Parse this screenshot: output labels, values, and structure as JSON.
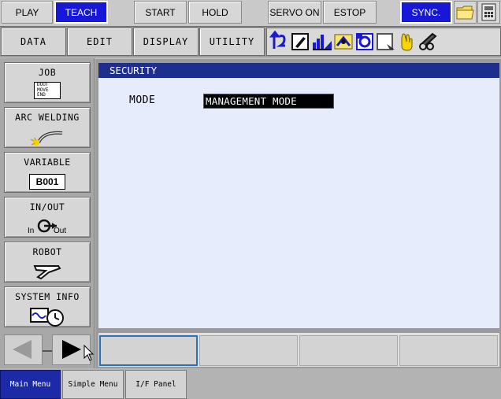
{
  "status_bar": {
    "play": "PLAY",
    "teach": "TEACH",
    "start": "START",
    "hold": "HOLD",
    "servo_on": "SERVO ON",
    "estop": "ESTOP",
    "sync": "SYNC.",
    "icons": [
      "folder-icon",
      "teach-pendant-icon"
    ]
  },
  "menu": {
    "data": "DATA",
    "edit": "EDIT",
    "display": "DISPLAY",
    "utility": "UTILITY",
    "status_icons": [
      "cycle-icon",
      "edit-icon",
      "signal-icon",
      "coordinate-icon",
      "tool-icon",
      "page-icon",
      "hand-icon",
      "security-key-icon"
    ]
  },
  "sidebar": {
    "items": [
      {
        "label": "JOB",
        "icon_text": [
          "DOUT",
          "MOVE",
          "END"
        ]
      },
      {
        "label": "ARC WELDING"
      },
      {
        "label": "VARIABLE",
        "icon_text": "B001"
      },
      {
        "label": "IN/OUT",
        "icon_text_in": "In",
        "icon_text_out": "Out"
      },
      {
        "label": "ROBOT"
      },
      {
        "label": "SYSTEM INFO"
      }
    ]
  },
  "window": {
    "title": "SECURITY",
    "mode_label": "MODE",
    "mode_value": "MANAGEMENT MODE"
  },
  "bottom_tabs": {
    "main_menu": "Main Menu",
    "simple_menu": "Simple Menu",
    "if_panel": "I/F Panel"
  },
  "colors": {
    "active_blue": "#1717d8",
    "title_bar": "#1e2e8e",
    "content_bg": "#e6ecfb",
    "selected_field": "#000000"
  }
}
